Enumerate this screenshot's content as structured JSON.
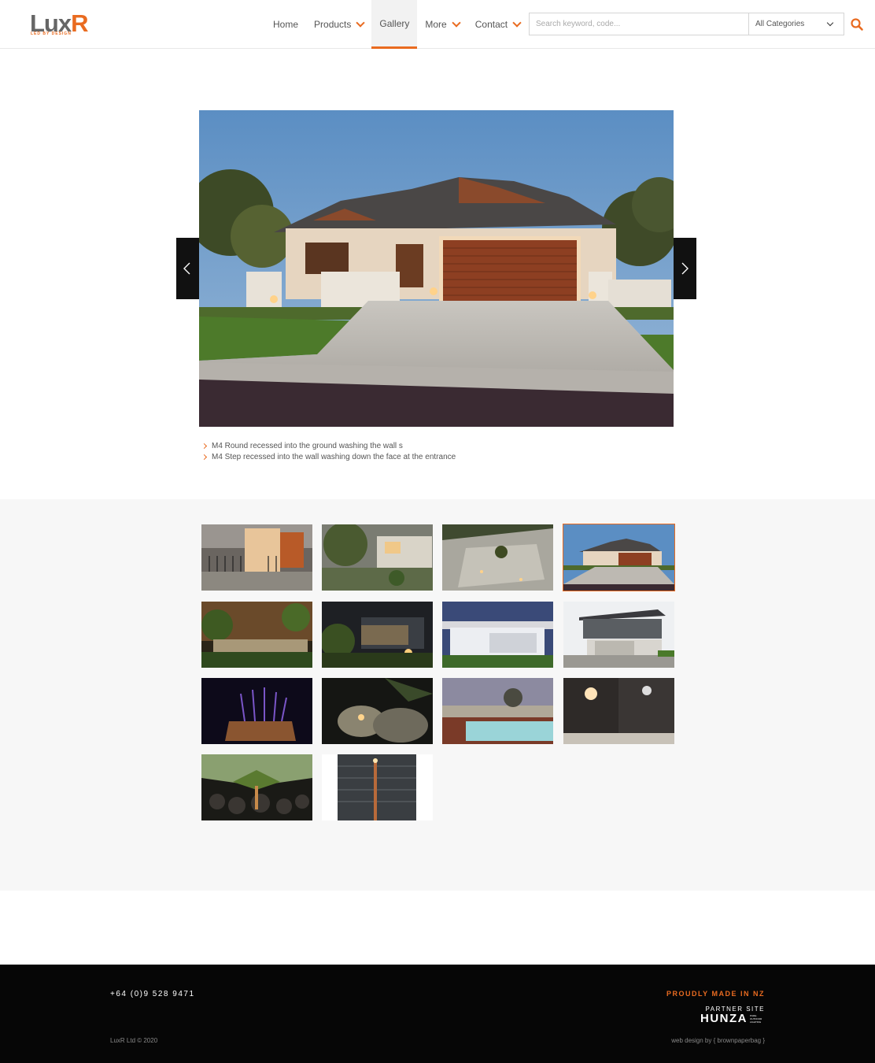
{
  "brand": {
    "name_main": "Lux",
    "name_accent": "R",
    "tagline": "LED BY DESIGN",
    "accent_color": "#e96b20"
  },
  "nav": {
    "items": [
      {
        "label": "Home",
        "has_dropdown": false,
        "active": false
      },
      {
        "label": "Products",
        "has_dropdown": true,
        "active": false
      },
      {
        "label": "Gallery",
        "has_dropdown": false,
        "active": true
      },
      {
        "label": "More",
        "has_dropdown": true,
        "active": false
      },
      {
        "label": "Contact",
        "has_dropdown": true,
        "active": false
      }
    ]
  },
  "search": {
    "placeholder": "Search keyword, code...",
    "category": "All Categories",
    "icon": "search-icon"
  },
  "hero": {
    "captions": [
      "M4 Round recessed into the ground washing the wall s",
      "M4 Step recessed into the wall washing down the face at the entrance"
    ]
  },
  "gallery": {
    "selected_index": 3,
    "count": 14
  },
  "footer": {
    "phone": "+64 (0)9 528 9471",
    "made_in": "PROUDLY MADE IN NZ",
    "partner_label": "PARTNER SITE",
    "partner_name": "HUNZA",
    "partner_sub": "PURE OUTDOOR LIGHTING",
    "copyright": "LuxR Ltd © 2020",
    "credit": "web design by { brownpaperbag }"
  }
}
